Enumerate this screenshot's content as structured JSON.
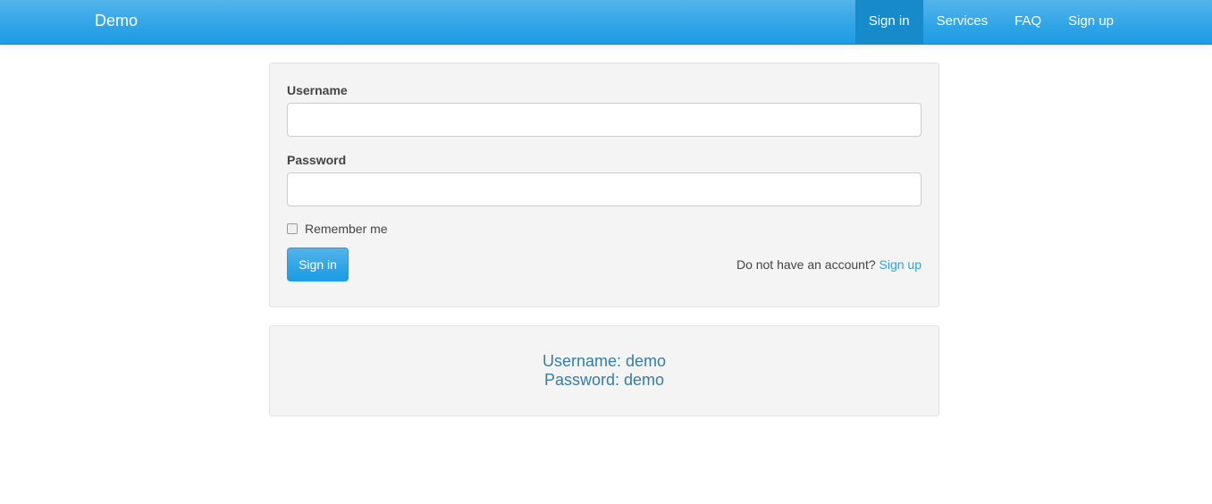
{
  "navbar": {
    "brand": "Demo",
    "items": [
      {
        "label": "Sign in",
        "active": true
      },
      {
        "label": "Services",
        "active": false
      },
      {
        "label": "FAQ",
        "active": false
      },
      {
        "label": "Sign up",
        "active": false
      }
    ]
  },
  "login_form": {
    "username_label": "Username",
    "username_value": "",
    "password_label": "Password",
    "password_value": "",
    "remember_label": "Remember me",
    "remember_checked": false,
    "signin_button": "Sign in",
    "no_account_text": "Do not have an account?",
    "signup_link": "Sign up"
  },
  "credentials_hint": {
    "username_line": "Username: demo",
    "password_line": "Password: demo"
  },
  "colors": {
    "navbar": "#2fa4e7",
    "nav_active": "#178acc",
    "link": "#2fa4e7",
    "hint_text": "#317eac",
    "panel_bg": "#f4f4f4"
  }
}
